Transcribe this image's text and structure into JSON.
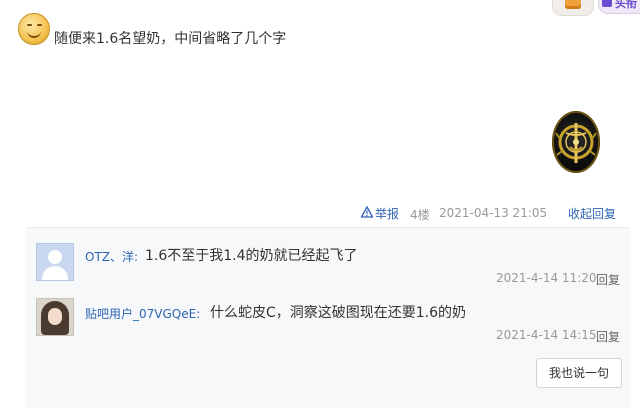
{
  "topbar": {
    "badge_right_text": "头衔"
  },
  "post": {
    "text": "随便来1.6名望奶，中间省略了几个字",
    "report_label": "举报",
    "floor": "4楼",
    "date": "2021-04-13 21:05",
    "collapse_label": "收起回复"
  },
  "replies": [
    {
      "user": "OTZ、洋:",
      "text": "1.6不至于我1.4的奶就已经起飞了",
      "date": "2021-4-14 11:20",
      "reply_label": "回复"
    },
    {
      "user": "贴吧用户_07VGQeE:",
      "text": "什么蛇皮C，洞察这破图现在还要1.6的奶",
      "date": "2021-4-14 14:15",
      "reply_label": "回复"
    }
  ],
  "say_button_label": "我也说一句",
  "colors": {
    "link": "#2d64b3",
    "meta": "#999999",
    "panel_bg": "#f7f8fa"
  }
}
